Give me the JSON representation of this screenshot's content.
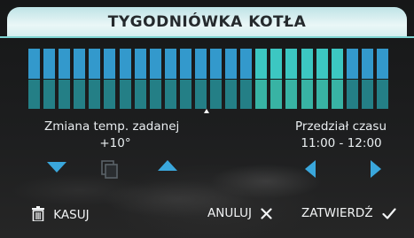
{
  "header": {
    "title": "TYGODNIÓWKA KOTŁA"
  },
  "schedule": {
    "bar_count": 24,
    "highlighted": [
      15,
      16,
      17,
      18,
      19,
      20
    ],
    "colors": {
      "top_normal": "#3399cc",
      "bottom_normal": "#247f86",
      "top_highlight": "#3cc7c2",
      "bottom_highlight": "#38b3a4"
    }
  },
  "temperature": {
    "label": "Zmiana temp. zadanej",
    "value": "+10°"
  },
  "time_range": {
    "label": "Przedział czasu",
    "value": "11:00 - 12:00"
  },
  "controls": {
    "decrease_icon": "triangle-down-icon",
    "copy_icon": "copy-icon",
    "increase_icon": "triangle-up-icon",
    "previous_icon": "triangle-left-icon",
    "next_icon": "triangle-right-icon",
    "accent": "#3aa7dc"
  },
  "footer": {
    "clear_label": "KASUJ",
    "cancel_label": "ANULUJ",
    "confirm_label": "ZATWIERDŹ"
  }
}
